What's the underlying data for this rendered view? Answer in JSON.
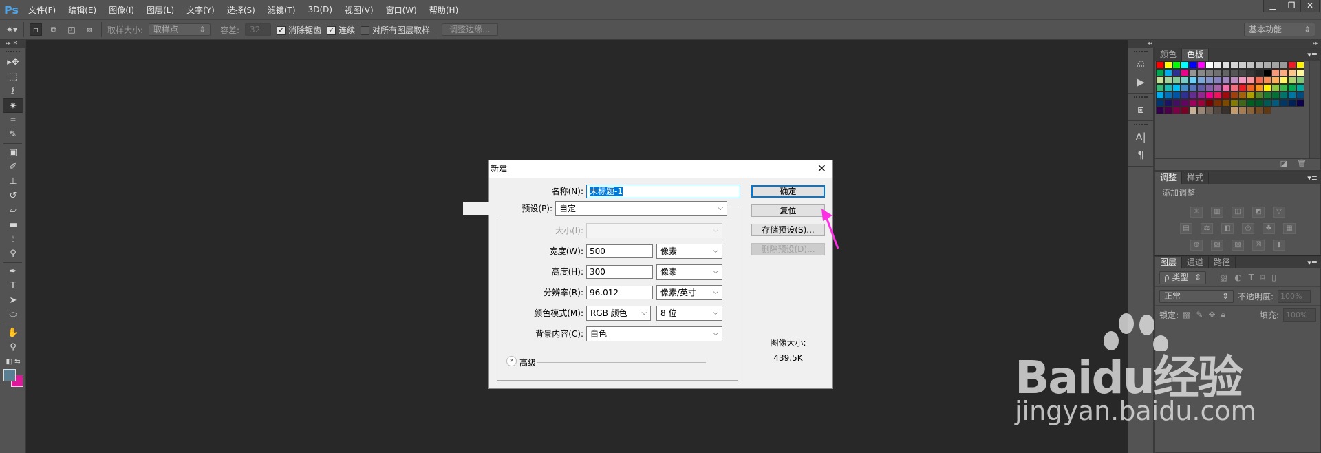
{
  "app": {
    "logo": "Ps"
  },
  "menu": [
    "文件(F)",
    "编辑(E)",
    "图像(I)",
    "图层(L)",
    "文字(Y)",
    "选择(S)",
    "滤镜(T)",
    "3D(D)",
    "视图(V)",
    "窗口(W)",
    "帮助(H)"
  ],
  "window_controls": {
    "minimize": "▁",
    "restore": "❐",
    "close": "✕"
  },
  "options": {
    "sample_size_label": "取样大小:",
    "sample_size_value": "取样点",
    "tolerance_label": "容差:",
    "tolerance_value": "32",
    "anti_alias": {
      "label": "消除锯齿",
      "checked": true
    },
    "contiguous": {
      "label": "连续",
      "checked": true
    },
    "all_layers": {
      "label": "对所有图层取样",
      "checked": false
    },
    "refine_edge": "调整边缘...",
    "workspace": "基本功能"
  },
  "tools": [
    "move",
    "marquee",
    "lasso",
    "magic-wand",
    "crop",
    "eyedropper",
    "healing",
    "brush",
    "stamp",
    "history-brush",
    "eraser",
    "gradient",
    "blur",
    "dodge",
    "pen",
    "type",
    "path-select",
    "ellipse",
    "hand",
    "zoom"
  ],
  "active_tool": "magic-wand",
  "colors": {
    "foreground": "#5a7f92",
    "background": "#e0179a"
  },
  "swatches_panel": {
    "tabs": [
      "颜色",
      "色板"
    ],
    "active_tab": "色板",
    "swatches": [
      "#ff0000",
      "#ffff00",
      "#00ff00",
      "#00ffff",
      "#0000ff",
      "#ff00ff",
      "#ffffff",
      "#ebebeb",
      "#e0e0e0",
      "#d6d6d6",
      "#cccccc",
      "#c2c2c2",
      "#b8b8b8",
      "#adadad",
      "#a3a3a3",
      "#999999",
      "#ed1c24",
      "#fff200",
      "#00a651",
      "#00aeef",
      "#2e3192",
      "#ec008c",
      "#959595",
      "#898989",
      "#7d7d7d",
      "#707070",
      "#646464",
      "#555555",
      "#464646",
      "#363636",
      "#262626",
      "#000000",
      "#f7977a",
      "#f9ad81",
      "#fdc68a",
      "#fff799",
      "#c4df9b",
      "#a3d39c",
      "#82ca9c",
      "#7accc8",
      "#6dcff6",
      "#7da7d9",
      "#8393ca",
      "#8781bd",
      "#a187be",
      "#bc8dbf",
      "#f49ac2",
      "#f6989d",
      "#f26c4f",
      "#f68e55",
      "#fbaf5c",
      "#fff467",
      "#acd372",
      "#7cc576",
      "#3bb878",
      "#1abbb4",
      "#00bff3",
      "#438cca",
      "#5574b9",
      "#605ca8",
      "#855fa8",
      "#a763a8",
      "#f06ea9",
      "#f26d7d",
      "#ed1c24",
      "#f26522",
      "#f7941d",
      "#fff200",
      "#8dc63f",
      "#39b54a",
      "#00a651",
      "#00a99d",
      "#00aeef",
      "#0072bc",
      "#0054a6",
      "#2e3192",
      "#662d91",
      "#92278f",
      "#ec008c",
      "#ed145b",
      "#9e0b0f",
      "#a0410d",
      "#a36209",
      "#aba000",
      "#598527",
      "#197b30",
      "#007236",
      "#00746b",
      "#0076a3",
      "#004b80",
      "#003471",
      "#1b1464",
      "#440e62",
      "#630460",
      "#9e005d",
      "#9e0039",
      "#790000",
      "#7b2e00",
      "#7d4900",
      "#827b00",
      "#406618",
      "#005e20",
      "#005826",
      "#005952",
      "#005b7f",
      "#003663",
      "#002157",
      "#0d004c",
      "#32004b",
      "#4b0049",
      "#7b0046",
      "#7a0026",
      "#c7b299",
      "#998675",
      "#736357",
      "#534741",
      "#37302d",
      "#c69c6d",
      "#a67c52",
      "#8c6239",
      "#754c24",
      "#603913"
    ]
  },
  "adjust_panel": {
    "tabs": [
      "调整",
      "样式"
    ],
    "active_tab": "调整",
    "title": "添加调整",
    "rows": [
      [
        "☼",
        "▥",
        "◫",
        "◩",
        "▽"
      ],
      [
        "▤",
        "⚖",
        "◧",
        "◎",
        "☘",
        "▦"
      ],
      [
        "◍",
        "▨",
        "▧",
        "☒",
        "▮"
      ]
    ]
  },
  "layers_panel": {
    "tabs": [
      "图层",
      "通道",
      "路径"
    ],
    "active_tab": "图层",
    "filter": "ρ 类型",
    "blend_mode": "正常",
    "opacity_label": "不透明度:",
    "opacity": "100%",
    "lock_label": "锁定:",
    "fill_label": "填充:",
    "fill": "100%"
  },
  "dialog": {
    "title": "新建",
    "name_label": "名称(N):",
    "name_value": "未标题-1",
    "preset_label": "预设(P):",
    "preset_value": "自定",
    "size_label": "大小(I):",
    "width_label": "宽度(W):",
    "width_value": "500",
    "width_unit": "像素",
    "height_label": "高度(H):",
    "height_value": "300",
    "height_unit": "像素",
    "resolution_label": "分辨率(R):",
    "resolution_value": "96.012",
    "resolution_unit": "像素/英寸",
    "color_mode_label": "颜色模式(M):",
    "color_mode_value": "RGB 颜色",
    "bit_depth": "8 位",
    "background_label": "背景内容(C):",
    "background_value": "白色",
    "advanced_label": "高级",
    "ok": "确定",
    "reset": "复位",
    "save_preset": "存储预设(S)...",
    "delete_preset": "删除预设(D)...",
    "image_size_label": "图像大小:",
    "image_size_value": "439.5K"
  },
  "annotation": {
    "arrow_color": "#ff2ee6"
  },
  "watermark": {
    "brand": "Baidu经验",
    "url": "jingyan.baidu.com"
  }
}
